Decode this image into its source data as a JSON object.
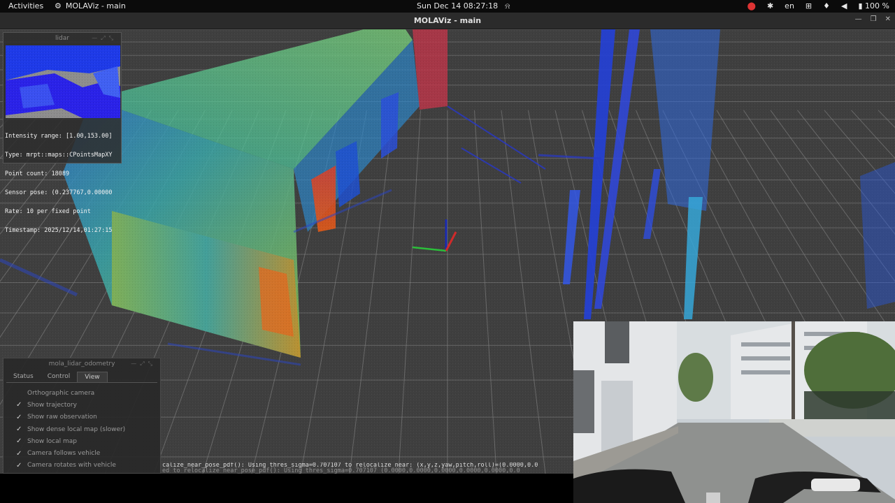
{
  "topbar": {
    "activities": "Activities",
    "app_name": "MOLAViz - main",
    "datetime": "Sun Dec 14  08:27:18",
    "lang": "en",
    "battery": "100 %"
  },
  "window": {
    "title": "MOLAViz - main"
  },
  "lidar_window": {
    "title": "lidar",
    "info_lines": [
      "Intensity range: [1.00,153.00]",
      "Type: mrpt::maps::CPointsMapXY",
      "Point count: 18089",
      "Sensor pose: (0.237767,0.00000",
      "Rate: 10 per fixed point",
      "Timestamp: 2025/12/14,01:27:15"
    ]
  },
  "odometry_window": {
    "title": "mola_lidar_odometry",
    "tabs": [
      "Status",
      "Control",
      "View"
    ],
    "active_tab": "View",
    "options": [
      {
        "label": "Orthographic camera",
        "checked": false
      },
      {
        "label": "Show trajectory",
        "checked": true
      },
      {
        "label": "Show raw observation",
        "checked": true
      },
      {
        "label": "Show dense local map (slower)",
        "checked": true
      },
      {
        "label": "Show local map",
        "checked": true
      },
      {
        "label": "Camera follows vehicle",
        "checked": true
      },
      {
        "label": "Camera rotates with vehicle",
        "checked": true
      }
    ]
  },
  "console": {
    "line1": "calize_near_pose_pdf(): Using thres_sigma=0.707107 to relocalize near: (x,y,z,yaw,pitch,roll)=(0.0000,0.0",
    "line2": "ed to relocalize near_pose_pdf(): Using thres_sigma=0.707107 (0.0000,0.0000,0.0000,0.0000,0.0000,0.0"
  },
  "icons": {
    "app": "app-icon",
    "alarm": "alarm-icon",
    "record": "record-icon",
    "accessibility": "accessibility-icon",
    "network": "network-icon",
    "mic": "microphone-icon",
    "volume": "volume-icon",
    "battery": "battery-icon"
  },
  "colors": {
    "viewport_bg": "#3f3f3f",
    "grid": "#8a8a8a",
    "topbar_bg": "#0b0b0b",
    "titlebar_bg": "#2b2b2b"
  }
}
